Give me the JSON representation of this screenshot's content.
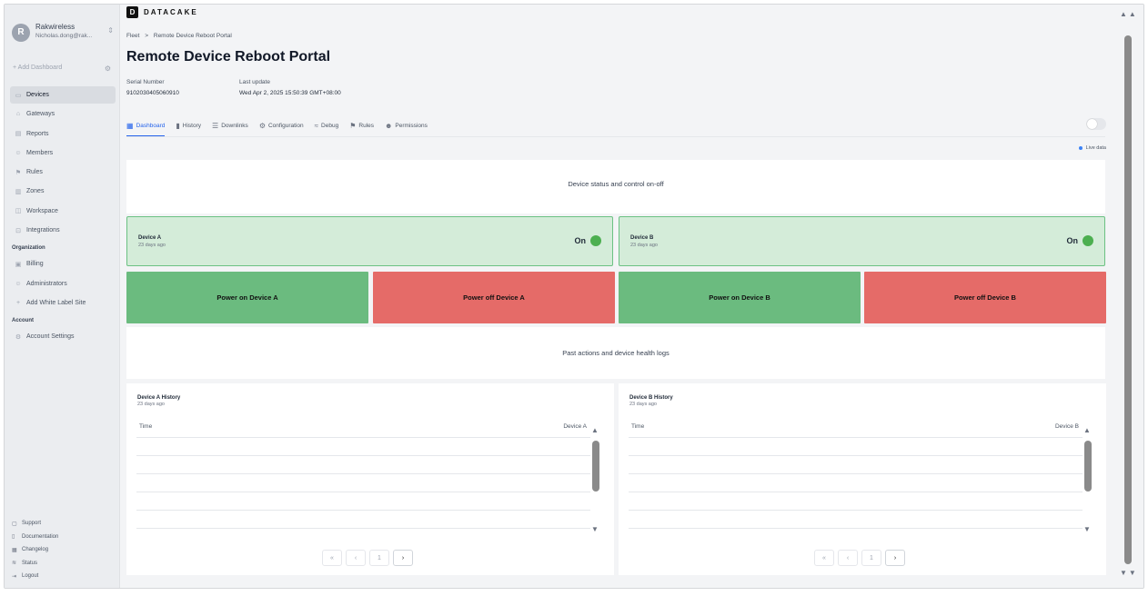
{
  "account": {
    "initial": "R",
    "name": "Rakwireless",
    "email": "Nicholas.dong@rak..."
  },
  "sidebar": {
    "add_dashboard": "Add Dashboard",
    "items": [
      {
        "label": "Devices",
        "icon": "devices-icon"
      },
      {
        "label": "Gateways",
        "icon": "gateway-icon"
      },
      {
        "label": "Reports",
        "icon": "report-icon"
      },
      {
        "label": "Members",
        "icon": "members-icon"
      },
      {
        "label": "Rules",
        "icon": "rules-icon"
      },
      {
        "label": "Zones",
        "icon": "zones-icon"
      },
      {
        "label": "Workspace",
        "icon": "workspace-icon"
      },
      {
        "label": "Integrations",
        "icon": "integrations-icon"
      }
    ],
    "org_heading": "Organization",
    "org_items": [
      {
        "label": "Billing"
      },
      {
        "label": "Administrators"
      },
      {
        "label": "Add White Label Site"
      }
    ],
    "account_heading": "Account",
    "account_items": [
      {
        "label": "Account Settings"
      }
    ],
    "footer": [
      {
        "label": "Support"
      },
      {
        "label": "Documentation"
      },
      {
        "label": "Changelog"
      },
      {
        "label": "Status"
      },
      {
        "label": "Logout"
      }
    ]
  },
  "brand": {
    "logo": "D",
    "name": "DATACAKE"
  },
  "breadcrumb": {
    "root": "Fleet",
    "sep": ">",
    "current": "Remote Device Reboot Portal"
  },
  "page": {
    "title": "Remote Device Reboot Portal",
    "serial_label": "Serial Number",
    "serial_value": "9102030405060910",
    "update_label": "Last update",
    "update_value": "Wed Apr 2, 2025 15:50:39 GMT+08:00"
  },
  "tabs": [
    "Dashboard",
    "History",
    "Downlinks",
    "Configuration",
    "Debug",
    "Rules",
    "Permissions"
  ],
  "live_data": "Live data",
  "dashboard": {
    "section1": "Device status and control on-off",
    "section2": "Past actions and device health logs",
    "devices": [
      {
        "name": "Device A",
        "ago": "23 days ago",
        "status": "On",
        "power_on": "Power on Device A",
        "power_off": "Power off Device A"
      },
      {
        "name": "Device B",
        "ago": "23 days ago",
        "status": "On",
        "power_on": "Power on Device B",
        "power_off": "Power off Device B"
      }
    ],
    "histories": [
      {
        "title": "Device A History",
        "ago": "23 days ago",
        "col_time": "Time",
        "col_value": "Device A",
        "page": "1"
      },
      {
        "title": "Device B History",
        "ago": "23 days ago",
        "col_time": "Time",
        "col_value": "Device B",
        "page": "1"
      }
    ]
  },
  "colors": {
    "status_bg": "#d4ecd9",
    "status_dot": "#4caf50",
    "power_on": "#6bbb7f",
    "power_off": "#e56b68",
    "accent": "#2563eb"
  }
}
